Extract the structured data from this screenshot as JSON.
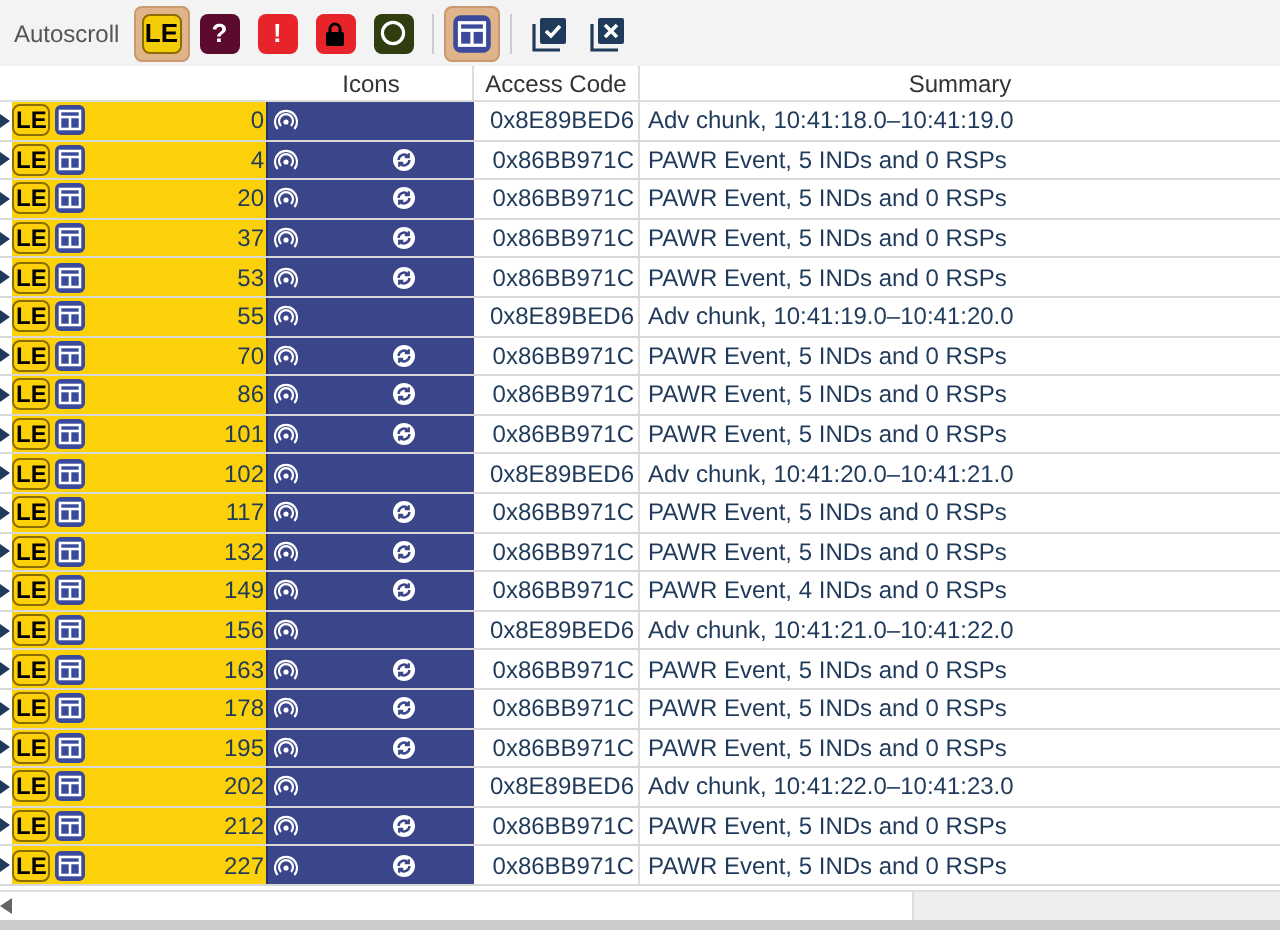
{
  "toolbar": {
    "autoscroll_label": "Autoscroll",
    "filters": [
      {
        "kind": "text",
        "label": "LE",
        "color": "#f5cc0a",
        "selected": true
      },
      {
        "kind": "text",
        "label": "?",
        "color": "#5c0a2e",
        "selected": false
      },
      {
        "kind": "text",
        "label": "!",
        "color": "#e8242b",
        "selected": false
      },
      {
        "kind": "lock",
        "color": "#e8242b",
        "selected": false
      },
      {
        "kind": "ring",
        "color": "#2f3d10",
        "selected": false
      }
    ],
    "layout_toggle": {
      "selected": true
    }
  },
  "table": {
    "columns": [
      "Icons",
      "Access Code",
      "Summary"
    ],
    "rows": [
      {
        "badge": "LE",
        "index": "0",
        "kind": "adv",
        "access_code": "0x8E89BED6",
        "summary": "Adv chunk, 10:41:18.0–10:41:19.0"
      },
      {
        "badge": "LE",
        "index": "4",
        "kind": "pawr",
        "access_code": "0x86BB971C",
        "summary": "PAWR Event, 5 INDs and 0 RSPs"
      },
      {
        "badge": "LE",
        "index": "20",
        "kind": "pawr",
        "access_code": "0x86BB971C",
        "summary": "PAWR Event, 5 INDs and 0 RSPs"
      },
      {
        "badge": "LE",
        "index": "37",
        "kind": "pawr",
        "access_code": "0x86BB971C",
        "summary": "PAWR Event, 5 INDs and 0 RSPs"
      },
      {
        "badge": "LE",
        "index": "53",
        "kind": "pawr",
        "access_code": "0x86BB971C",
        "summary": "PAWR Event, 5 INDs and 0 RSPs"
      },
      {
        "badge": "LE",
        "index": "55",
        "kind": "adv",
        "access_code": "0x8E89BED6",
        "summary": "Adv chunk, 10:41:19.0–10:41:20.0"
      },
      {
        "badge": "LE",
        "index": "70",
        "kind": "pawr",
        "access_code": "0x86BB971C",
        "summary": "PAWR Event, 5 INDs and 0 RSPs"
      },
      {
        "badge": "LE",
        "index": "86",
        "kind": "pawr",
        "access_code": "0x86BB971C",
        "summary": "PAWR Event, 5 INDs and 0 RSPs"
      },
      {
        "badge": "LE",
        "index": "101",
        "kind": "pawr",
        "access_code": "0x86BB971C",
        "summary": "PAWR Event, 5 INDs and 0 RSPs"
      },
      {
        "badge": "LE",
        "index": "102",
        "kind": "adv",
        "access_code": "0x8E89BED6",
        "summary": "Adv chunk, 10:41:20.0–10:41:21.0"
      },
      {
        "badge": "LE",
        "index": "117",
        "kind": "pawr",
        "access_code": "0x86BB971C",
        "summary": "PAWR Event, 5 INDs and 0 RSPs"
      },
      {
        "badge": "LE",
        "index": "132",
        "kind": "pawr",
        "access_code": "0x86BB971C",
        "summary": "PAWR Event, 5 INDs and 0 RSPs"
      },
      {
        "badge": "LE",
        "index": "149",
        "kind": "pawr",
        "access_code": "0x86BB971C",
        "summary": "PAWR Event, 4 INDs and 0 RSPs"
      },
      {
        "badge": "LE",
        "index": "156",
        "kind": "adv",
        "access_code": "0x8E89BED6",
        "summary": "Adv chunk, 10:41:21.0–10:41:22.0"
      },
      {
        "badge": "LE",
        "index": "163",
        "kind": "pawr",
        "access_code": "0x86BB971C",
        "summary": "PAWR Event, 5 INDs and 0 RSPs"
      },
      {
        "badge": "LE",
        "index": "178",
        "kind": "pawr",
        "access_code": "0x86BB971C",
        "summary": "PAWR Event, 5 INDs and 0 RSPs"
      },
      {
        "badge": "LE",
        "index": "195",
        "kind": "pawr",
        "access_code": "0x86BB971C",
        "summary": "PAWR Event, 5 INDs and 0 RSPs"
      },
      {
        "badge": "LE",
        "index": "202",
        "kind": "adv",
        "access_code": "0x8E89BED6",
        "summary": "Adv chunk, 10:41:22.0–10:41:23.0"
      },
      {
        "badge": "LE",
        "index": "212",
        "kind": "pawr",
        "access_code": "0x86BB971C",
        "summary": "PAWR Event, 5 INDs and 0 RSPs"
      },
      {
        "badge": "LE",
        "index": "227",
        "kind": "pawr",
        "access_code": "0x86BB971C",
        "summary": "PAWR Event, 5 INDs and 0 RSPs"
      }
    ]
  }
}
